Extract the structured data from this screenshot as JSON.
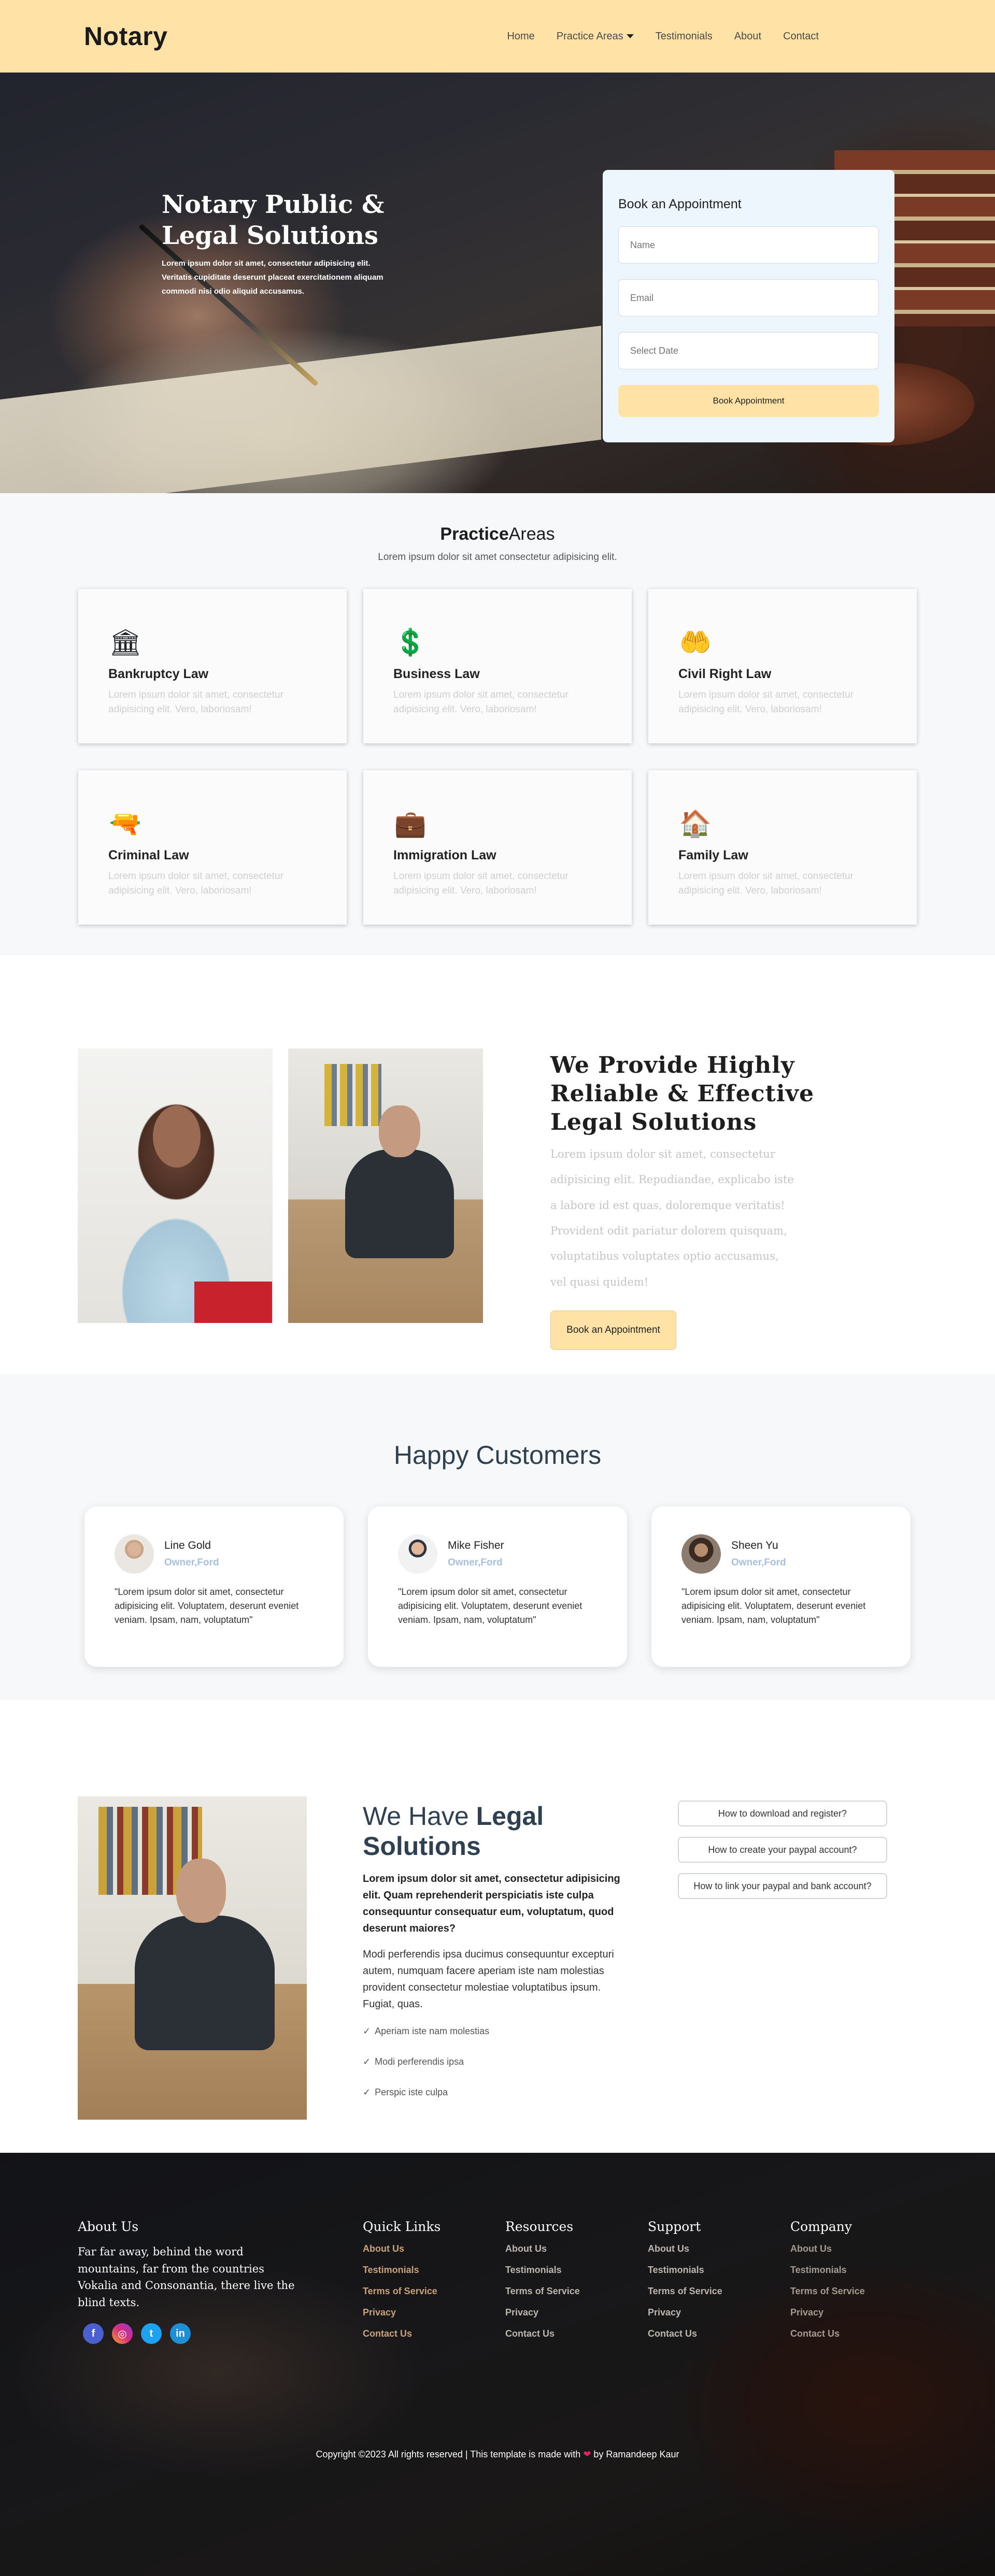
{
  "header": {
    "brand": "Notary",
    "nav": [
      {
        "label": "Home"
      },
      {
        "label": "Practice Areas"
      },
      {
        "label": "Testimonials"
      },
      {
        "label": "About"
      },
      {
        "label": "Contact"
      }
    ]
  },
  "hero": {
    "title": "Notary Public & Legal Solutions",
    "subtitle": "Lorem ipsum dolor sit amet, consectetur adipisicing elit. Veritatis cupiditate deserunt placeat exercitationem aliquam commodi nisi odio aliquid accusamus.",
    "form": {
      "title": "Book an Appointment",
      "name_placeholder": "Name",
      "email_placeholder": "Email",
      "date_placeholder": "Select Date",
      "submit_label": "Book Appointment"
    }
  },
  "practice": {
    "title_bold": "Practice",
    "title_rest": "Areas",
    "subtitle": "Lorem ipsum dolor sit amet consectetur adipisicing elit.",
    "cards": [
      {
        "icon": "bank-icon",
        "glyph": "🏛",
        "title": "Bankruptcy Law",
        "text": "Lorem ipsum dolor sit amet, consectetur adipisicing elit. Vero, laboriosam!"
      },
      {
        "icon": "dollar-shield-icon",
        "glyph": "💲",
        "title": "Business Law",
        "text": "Lorem ipsum dolor sit amet, consectetur adipisicing elit. Vero, laboriosam!"
      },
      {
        "icon": "helping-hands-icon",
        "glyph": "🤲",
        "title": "Civil Right Law",
        "text": "Lorem ipsum dolor sit amet, consectetur adipisicing elit. Vero, laboriosam!"
      },
      {
        "icon": "gun-icon",
        "glyph": "🔫",
        "title": "Criminal Law",
        "text": "Lorem ipsum dolor sit amet, consectetur adipisicing elit. Vero, laboriosam!"
      },
      {
        "icon": "suitcase-icon",
        "glyph": "💼",
        "title": "Immigration Law",
        "text": "Lorem ipsum dolor sit amet, consectetur adipisicing elit. Vero, laboriosam!"
      },
      {
        "icon": "house-heart-icon",
        "glyph": "🏠",
        "title": "Family Law",
        "text": "Lorem ipsum dolor sit amet, consectetur adipisicing elit. Vero, laboriosam!"
      }
    ]
  },
  "reliable": {
    "title": "We Provide Highly Reliable & Effective Legal Solutions",
    "body": "Lorem ipsum dolor sit amet, consectetur adipisicing elit. Repudiandae, explicabo iste a labore id est quas, doloremque veritatis! Provident odit pariatur dolorem quisquam, voluptatibus voluptates optio accusamus, vel quasi quidem!",
    "button_label": "Book an Appointment"
  },
  "testimonials": {
    "title": "Happy Customers",
    "items": [
      {
        "name": "Line Gold",
        "role": "Owner,Ford",
        "quote": "\"Lorem ipsum dolor sit amet, consectetur adipisicing elit. Voluptatem, deserunt eveniet veniam. Ipsam, nam, voluptatum\""
      },
      {
        "name": "Mike Fisher",
        "role": "Owner,Ford",
        "quote": "\"Lorem ipsum dolor sit amet, consectetur adipisicing elit. Voluptatem, deserunt eveniet veniam. Ipsam, nam, voluptatum\""
      },
      {
        "name": "Sheen Yu",
        "role": "Owner,Ford",
        "quote": "\"Lorem ipsum dolor sit amet, consectetur adipisicing elit. Voluptatem, deserunt eveniet veniam. Ipsam, nam, voluptatum\""
      }
    ]
  },
  "legal": {
    "title_start": "We Have ",
    "title_bold": "Legal Solutions",
    "lead": "Lorem ipsum dolor sit amet, consectetur adipisicing elit. Quam reprehenderit perspiciatis iste culpa consequuntur consequatur eum, voluptatum, quod deserunt maiores?",
    "body": "Modi perferendis ipsa ducimus consequuntur excepturi autem, numquam facere aperiam iste nam molestias provident consectetur molestiae voluptatibus ipsum. Fugiat, quas.",
    "checks": [
      "Aperiam iste nam molestias",
      "Modi perferendis ipsa",
      "Perspic iste culpa"
    ],
    "faq": [
      "How to download and register?",
      "How to create your paypal account?",
      "How to link your paypal and bank account?"
    ]
  },
  "footer": {
    "about_heading": "About Us",
    "about_text": "Far far away, behind the word mountains, far from the countries Vokalia and Consonantia, there live the blind texts.",
    "socials": [
      "facebook-icon",
      "instagram-icon",
      "twitter-icon",
      "linkedin-icon"
    ],
    "columns": [
      {
        "heading": "Quick Links",
        "links": [
          "About Us",
          "Testimonials",
          "Terms of Service",
          "Privacy",
          "Contact Us"
        ],
        "color": "#c9a27a"
      },
      {
        "heading": "Resources",
        "links": [
          "About Us",
          "Testimonials",
          "Terms of Service",
          "Privacy",
          "Contact Us"
        ],
        "color": "#bdb6ae"
      },
      {
        "heading": "Support",
        "links": [
          "About Us",
          "Testimonials",
          "Terms of Service",
          "Privacy",
          "Contact Us"
        ],
        "color": "#bdb6ae"
      },
      {
        "heading": "Company",
        "links": [
          "About Us",
          "Testimonials",
          "Terms of Service",
          "Privacy",
          "Contact Us"
        ],
        "color": "#a59a90"
      }
    ],
    "copyright_start": "Copyright ©2023 All rights reserved | This template is made with ",
    "copyright_end": " by Ramandeep Kaur"
  }
}
